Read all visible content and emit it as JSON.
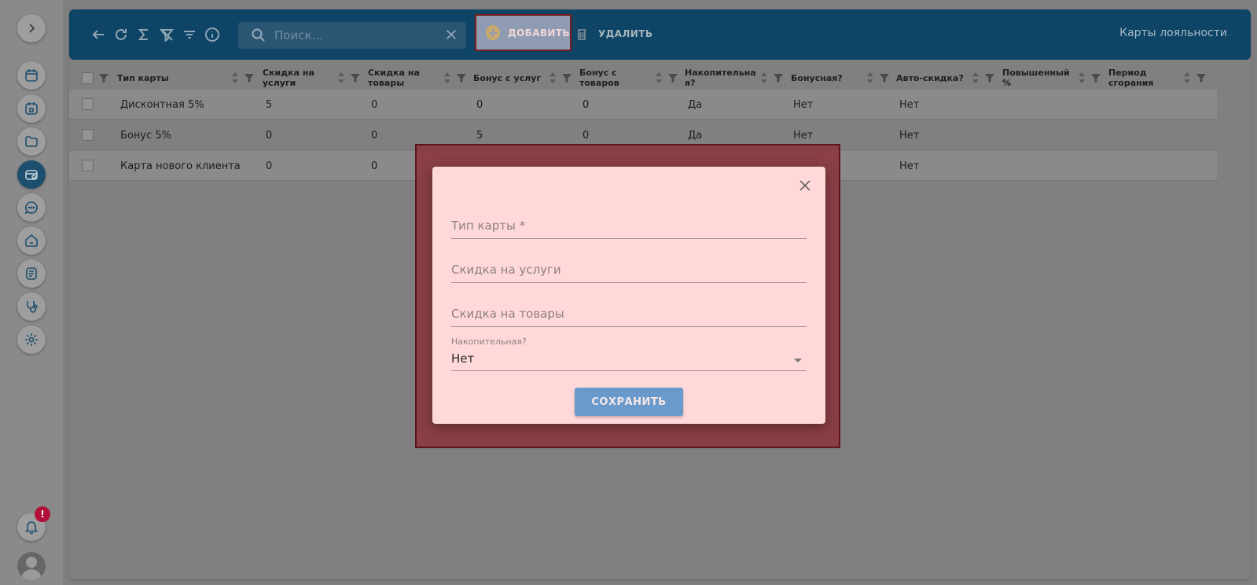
{
  "toolbar": {
    "search_placeholder": "Поиск...",
    "add_label": "ДОБАВИТЬ",
    "delete_label": "УДАЛИТЬ",
    "title": "Карты лояльности"
  },
  "notifications": {
    "badge": "!"
  },
  "table": {
    "columns": [
      "Тип карты",
      "Скидка на услуги",
      "Скидка на товары",
      "Бонус с услуг",
      "Бонус с товаров",
      "Накопительна я?",
      "Бонусная?",
      "Авто-скидка?",
      "Повышенный %",
      "Период сгорания"
    ],
    "rows": [
      [
        "Дисконтная 5%",
        "5",
        "0",
        "0",
        "0",
        "Да",
        "Нет",
        "Нет"
      ],
      [
        "Бонус 5%",
        "0",
        "0",
        "5",
        "0",
        "Да",
        "Нет",
        "Нет"
      ],
      [
        "Карта нового клиента",
        "0",
        "0",
        "",
        "",
        "",
        "",
        "Нет"
      ]
    ]
  },
  "dialog": {
    "card_type_placeholder": "Тип карты *",
    "service_discount_placeholder": "Скидка на услуги",
    "goods_discount_placeholder": "Скидка на товары",
    "cumulative_label": "Накопительная?",
    "cumulative_value": "Нет",
    "save_label": "СОХРАНИТЬ"
  },
  "colors": {
    "toolbar_bg": "#0e4566",
    "dialog_bg": "#ffd9da",
    "save_button": "#6a9acb",
    "badge": "#b0103a"
  }
}
